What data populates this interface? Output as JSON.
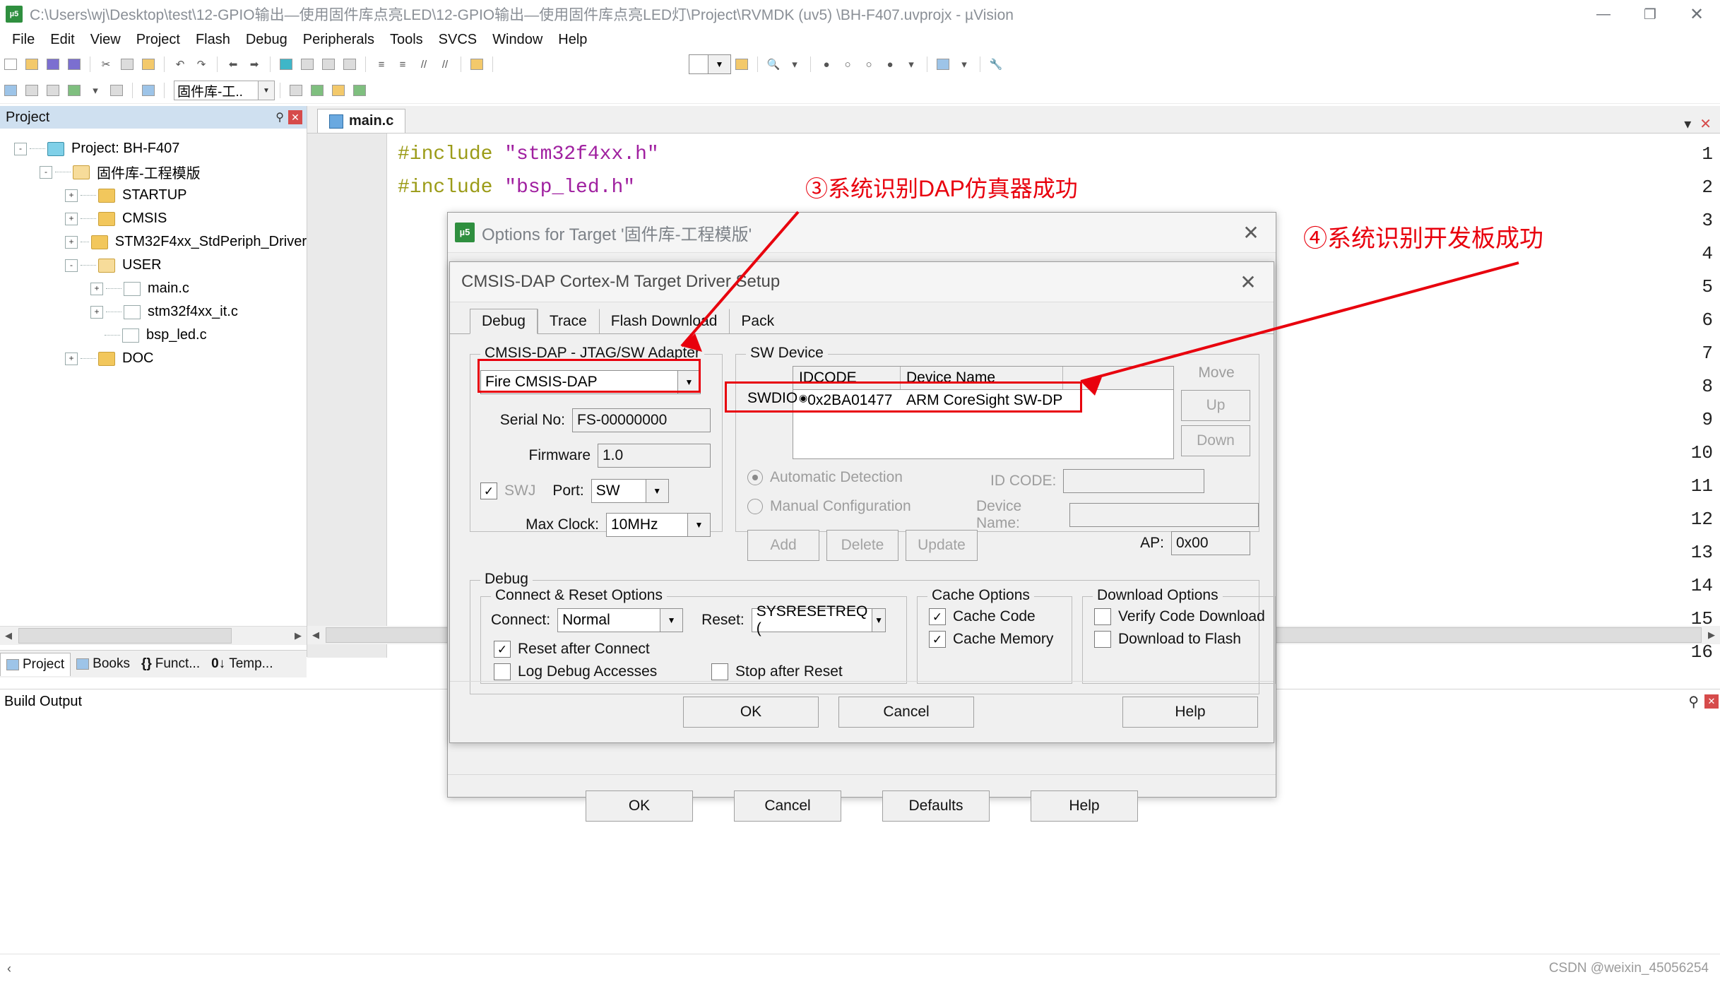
{
  "window": {
    "title": "C:\\Users\\wj\\Desktop\\test\\12-GPIO输出—使用固件库点亮LED\\12-GPIO输出—使用固件库点亮LED灯\\Project\\RVMDK (uv5) \\BH-F407.uvprojx - µVision",
    "app_badge": "µ5",
    "minimize": "—",
    "maximize": "❐",
    "close": "✕"
  },
  "menubar": [
    "File",
    "Edit",
    "View",
    "Project",
    "Flash",
    "Debug",
    "Peripherals",
    "Tools",
    "SVCS",
    "Window",
    "Help"
  ],
  "toolbar2": {
    "target_combo_value": "固件库-工..",
    "dropdown_arrow": "▼"
  },
  "project_panel": {
    "title": "Project",
    "pin": "⚲",
    "close": "✕",
    "tree": [
      {
        "indent": 0,
        "expander": "-",
        "icon": "project-icon",
        "label": "Project: BH-F407"
      },
      {
        "indent": 1,
        "expander": "-",
        "icon": "folder-open-icon",
        "label": "固件库-工程模版"
      },
      {
        "indent": 2,
        "expander": "+",
        "icon": "folder-icon",
        "label": "STARTUP"
      },
      {
        "indent": 2,
        "expander": "+",
        "icon": "folder-icon",
        "label": "CMSIS"
      },
      {
        "indent": 2,
        "expander": "+",
        "icon": "folder-icon",
        "label": "STM32F4xx_StdPeriph_Driver"
      },
      {
        "indent": 2,
        "expander": "-",
        "icon": "folder-open-icon",
        "label": "USER"
      },
      {
        "indent": 3,
        "expander": "+",
        "icon": "file-icon",
        "label": "main.c"
      },
      {
        "indent": 3,
        "expander": "+",
        "icon": "file-icon",
        "label": "stm32f4xx_it.c"
      },
      {
        "indent": 3,
        "expander": "",
        "icon": "file-icon",
        "label": "bsp_led.c"
      },
      {
        "indent": 2,
        "expander": "+",
        "icon": "folder-icon",
        "label": "DOC"
      }
    ],
    "bottom_tabs": [
      {
        "label": "Project",
        "icon": "project-tab-icon",
        "active": true
      },
      {
        "label": "Books",
        "icon": "books-icon",
        "active": false
      },
      {
        "label": "Funct...",
        "icon": "functions-icon",
        "active": false
      },
      {
        "label": "Temp...",
        "icon": "templates-icon",
        "active": false
      }
    ]
  },
  "editor": {
    "tab_label": "main.c",
    "lines": [
      {
        "n": "1",
        "segments": [
          {
            "t": "#include ",
            "c": "kw"
          },
          {
            "t": "\"stm32f4xx.h\"",
            "c": "str"
          }
        ]
      },
      {
        "n": "2",
        "segments": [
          {
            "t": "#include ",
            "c": "kw"
          },
          {
            "t": "\"bsp_led.h\"",
            "c": "str"
          }
        ]
      },
      {
        "n": "3",
        "segments": []
      },
      {
        "n": "4",
        "segments": []
      },
      {
        "n": "5",
        "segments": []
      },
      {
        "n": "6",
        "segments": []
      },
      {
        "n": "7",
        "segments": []
      },
      {
        "n": "8",
        "segments": []
      },
      {
        "n": "9",
        "segments": []
      },
      {
        "n": "10",
        "segments": []
      },
      {
        "n": "11",
        "segments": []
      },
      {
        "n": "12",
        "segments": []
      },
      {
        "n": "13",
        "segments": []
      },
      {
        "n": "14",
        "segments": []
      },
      {
        "n": "15",
        "segments": []
      },
      {
        "n": "16",
        "segments": []
      }
    ]
  },
  "build_output": {
    "title": "Build Output",
    "pin": "⚲",
    "close": "✕"
  },
  "status_bar": {
    "left": "",
    "watermark": "CSDN @weixin_45056254"
  },
  "options_dialog": {
    "title": "Options for Target '固件库-工程模版'",
    "close": "✕",
    "buttons": [
      "OK",
      "Cancel",
      "Defaults",
      "Help"
    ]
  },
  "cmsis_dialog": {
    "title": "CMSIS-DAP Cortex-M Target Driver Setup",
    "close": "✕",
    "tabs": [
      {
        "label": "Debug",
        "active": true
      },
      {
        "label": "Trace",
        "active": false
      },
      {
        "label": "Flash Download",
        "active": false
      },
      {
        "label": "Pack",
        "active": false
      }
    ],
    "adapter_group": {
      "label": "CMSIS-DAP - JTAG/SW Adapter",
      "adapter_value": "Fire CMSIS-DAP",
      "serial_no_label": "Serial No:",
      "serial_no_value": "FS-00000000",
      "firmware_label": "Firmware",
      "firmware_value": "1.0",
      "swj_label": "SWJ",
      "swj_checked": true,
      "port_label": "Port:",
      "port_value": "SW",
      "max_clock_label": "Max Clock:",
      "max_clock_value": "10MHz"
    },
    "sw_device_group": {
      "label": "SW Device",
      "columns": [
        "IDCODE",
        "Device Name",
        "Move"
      ],
      "row": {
        "pin": "SWDIO",
        "idcode": "0x2BA01477",
        "device_name": "ARM CoreSight SW-DP"
      },
      "move_up": "Up",
      "move_down": "Down",
      "automatic_detection": "Automatic Detection",
      "automatic_selected": true,
      "manual_configuration": "Manual Configuration",
      "id_code_label": "ID CODE:",
      "id_code_value": "",
      "device_name_label": "Device Name:",
      "device_name_value": "",
      "add": "Add",
      "delete": "Delete",
      "update": "Update",
      "ap_label": "AP:",
      "ap_value": "0x00"
    },
    "debug_group": {
      "label": "Debug",
      "connect_reset": {
        "label": "Connect & Reset Options",
        "connect_label": "Connect:",
        "connect_value": "Normal",
        "reset_label": "Reset:",
        "reset_value": "SYSRESETREQ (",
        "reset_after_connect": "Reset after Connect",
        "reset_after_connect_checked": true,
        "log_debug_accesses": "Log Debug Accesses",
        "log_debug_accesses_checked": false,
        "stop_after_reset": "Stop after Reset",
        "stop_after_reset_checked": false
      },
      "cache_options": {
        "label": "Cache Options",
        "cache_code": "Cache Code",
        "cache_code_checked": true,
        "cache_memory": "Cache Memory",
        "cache_memory_checked": true
      },
      "download_options": {
        "label": "Download Options",
        "verify_code_download": "Verify Code Download",
        "verify_code_download_checked": false,
        "download_to_flash": "Download to Flash",
        "download_to_flash_checked": false
      }
    },
    "footer_buttons": [
      "OK",
      "Cancel",
      "Help"
    ]
  },
  "annotations": {
    "note3": "③系统识别DAP仿真器成功",
    "note4": "④系统识别开发板成功",
    "highlight_color": "#e8000d"
  }
}
